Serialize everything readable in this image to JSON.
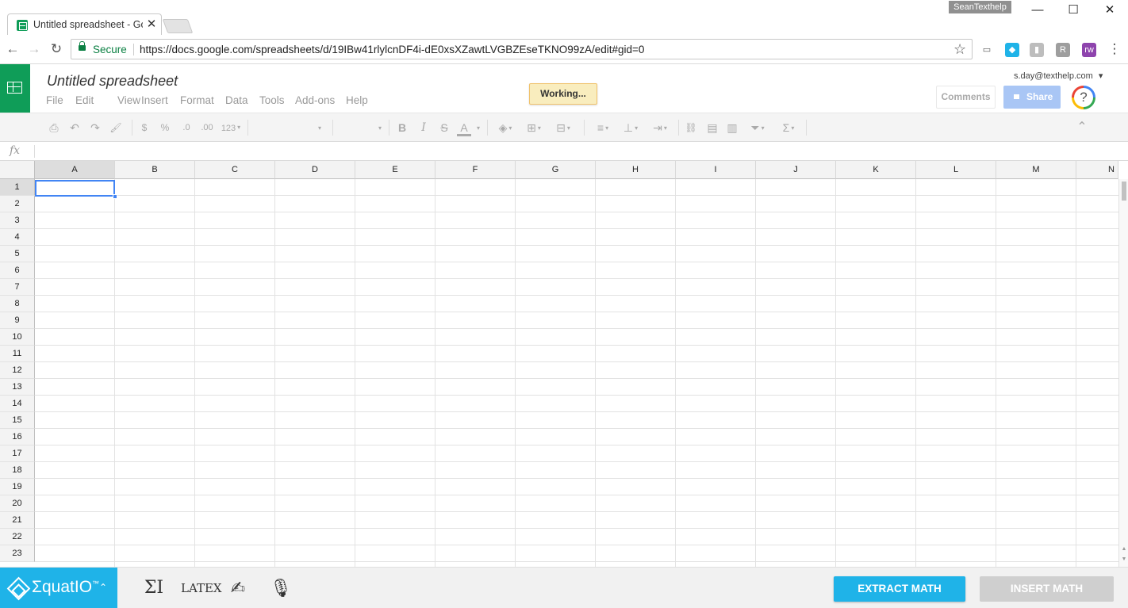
{
  "browser": {
    "tab_title": "Untitled spreadsheet - Go",
    "tab_close": "✕",
    "profile_name": "SeanTexthelp",
    "window": {
      "minimize": "—",
      "maximize": "☐",
      "close": "✕"
    },
    "nav": {
      "back": "←",
      "forward": "→",
      "reload": "↻"
    },
    "secure_label": "Secure",
    "url": "https://docs.google.com/spreadsheets/d/19IBw41rlylcnDF4i-dE0xsXZawtLVGBZEseTKNO99zA/edit#gid=0",
    "star": "☆",
    "extensions": [
      {
        "name": "cast-icon",
        "glyph": "▭",
        "color": "#ffffff",
        "text_color": "#555555"
      },
      {
        "name": "equatio-extension-icon",
        "glyph": "◆",
        "color": "#1fb3e8",
        "text_color": "#ffffff"
      },
      {
        "name": "grey-extension-icon",
        "glyph": "▮",
        "color": "#bdbdbd",
        "text_color": "#ffffff"
      },
      {
        "name": "r-extension-icon",
        "glyph": "R",
        "color": "#9e9e9e",
        "text_color": "#ffffff"
      },
      {
        "name": "puzzle-extension-icon",
        "glyph": "rw",
        "color": "#8e44ad",
        "text_color": "#ffffff"
      }
    ],
    "menu": "⋮"
  },
  "sheets": {
    "title": "Untitled spreadsheet",
    "menus": [
      "File",
      "Edit",
      "View",
      "Insert",
      "Format",
      "Data",
      "Tools",
      "Add-ons",
      "Help"
    ],
    "status": "Working...",
    "account": "s.day@texthelp.com",
    "account_caret": "▾",
    "comments_label": "Comments",
    "share_label": "Share",
    "help_glyph": "?"
  },
  "toolbar": {
    "print": "⎙",
    "undo": "↶",
    "redo": "↷",
    "paint_format": "🖌",
    "currency": "$",
    "percent": "%",
    "dec_decrease": ".0",
    "dec_increase": ".00",
    "more_formats": "123",
    "bold": "B",
    "italic": "I",
    "strike": "S",
    "text_color": "A",
    "fill_color": "◈",
    "borders": "⊞",
    "merge": "⊟",
    "align": "≡",
    "valign": "⊥",
    "wrap": "⇥",
    "link": "⛓",
    "comment": "▤",
    "chart": "▥",
    "filter": "⏷",
    "functions": "Σ",
    "collapse": "⌃",
    "caret": "▾"
  },
  "formula": {
    "fx": "fx",
    "value": ""
  },
  "grid": {
    "columns": [
      "A",
      "B",
      "C",
      "D",
      "E",
      "F",
      "G",
      "H",
      "I",
      "J",
      "K",
      "L",
      "M",
      "N"
    ],
    "rows": [
      "1",
      "2",
      "3",
      "4",
      "5",
      "6",
      "7",
      "8",
      "9",
      "10",
      "11",
      "12",
      "13",
      "14",
      "15",
      "16",
      "17",
      "18",
      "19",
      "20",
      "21",
      "22",
      "23"
    ],
    "active_cell": "A1",
    "scroll_up": "▲",
    "scroll_down": "▼"
  },
  "equatio": {
    "brand": "ΣquatIO",
    "trademark": "™",
    "caret": "⌃",
    "tools": {
      "math_input": "ΣI",
      "latex": "LATEX",
      "handwriting": "✍",
      "speech": "🎙"
    },
    "extract_label": "EXTRACT MATH",
    "insert_label": "INSERT MATH"
  }
}
